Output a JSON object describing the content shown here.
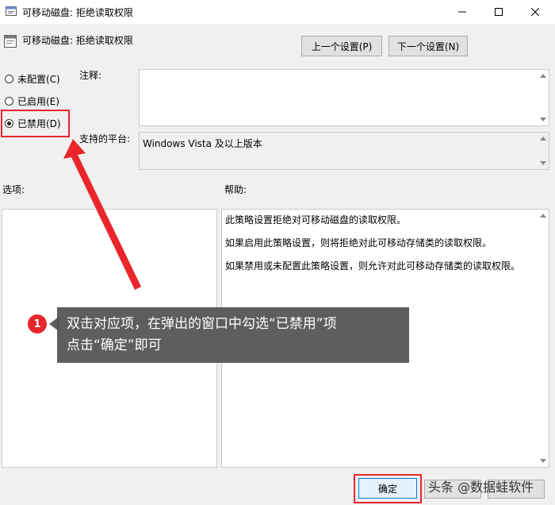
{
  "window": {
    "title": "可移动磁盘: 拒绝读取权限",
    "minimize_icon": "minimize-icon",
    "maximize_icon": "maximize-icon",
    "close_icon": "close-icon"
  },
  "header": {
    "policy_title": "可移动磁盘: 拒绝读取权限",
    "prev_button": "上一个设置(P)",
    "next_button": "下一个设置(N)"
  },
  "state": {
    "options": [
      {
        "label": "未配置(C)",
        "selected": false
      },
      {
        "label": "已启用(E)",
        "selected": false
      },
      {
        "label": "已禁用(D)",
        "selected": true
      }
    ]
  },
  "comment": {
    "label": "注释:",
    "value": ""
  },
  "platform": {
    "label": "支持的平台:",
    "value": "Windows Vista 及以上版本"
  },
  "options_panel": {
    "label": "选项:"
  },
  "help_panel": {
    "label": "帮助:",
    "paragraphs": [
      "此策略设置拒绝对可移动磁盘的读取权限。",
      "如果启用此策略设置，则将拒绝对此可移动存储类的读取权限。",
      "如果禁用或未配置此策略设置，则允许对此可移动存储类的读取权限。"
    ]
  },
  "annotation": {
    "step_number": "1",
    "line1": "双击对应项，在弹出的窗口中勾选“已禁用”项",
    "line2": "点击“确定”即可",
    "accent_color": "#e8262b"
  },
  "footer": {
    "ok_button": "确定"
  },
  "watermark": "头条 @数据蛙软件"
}
